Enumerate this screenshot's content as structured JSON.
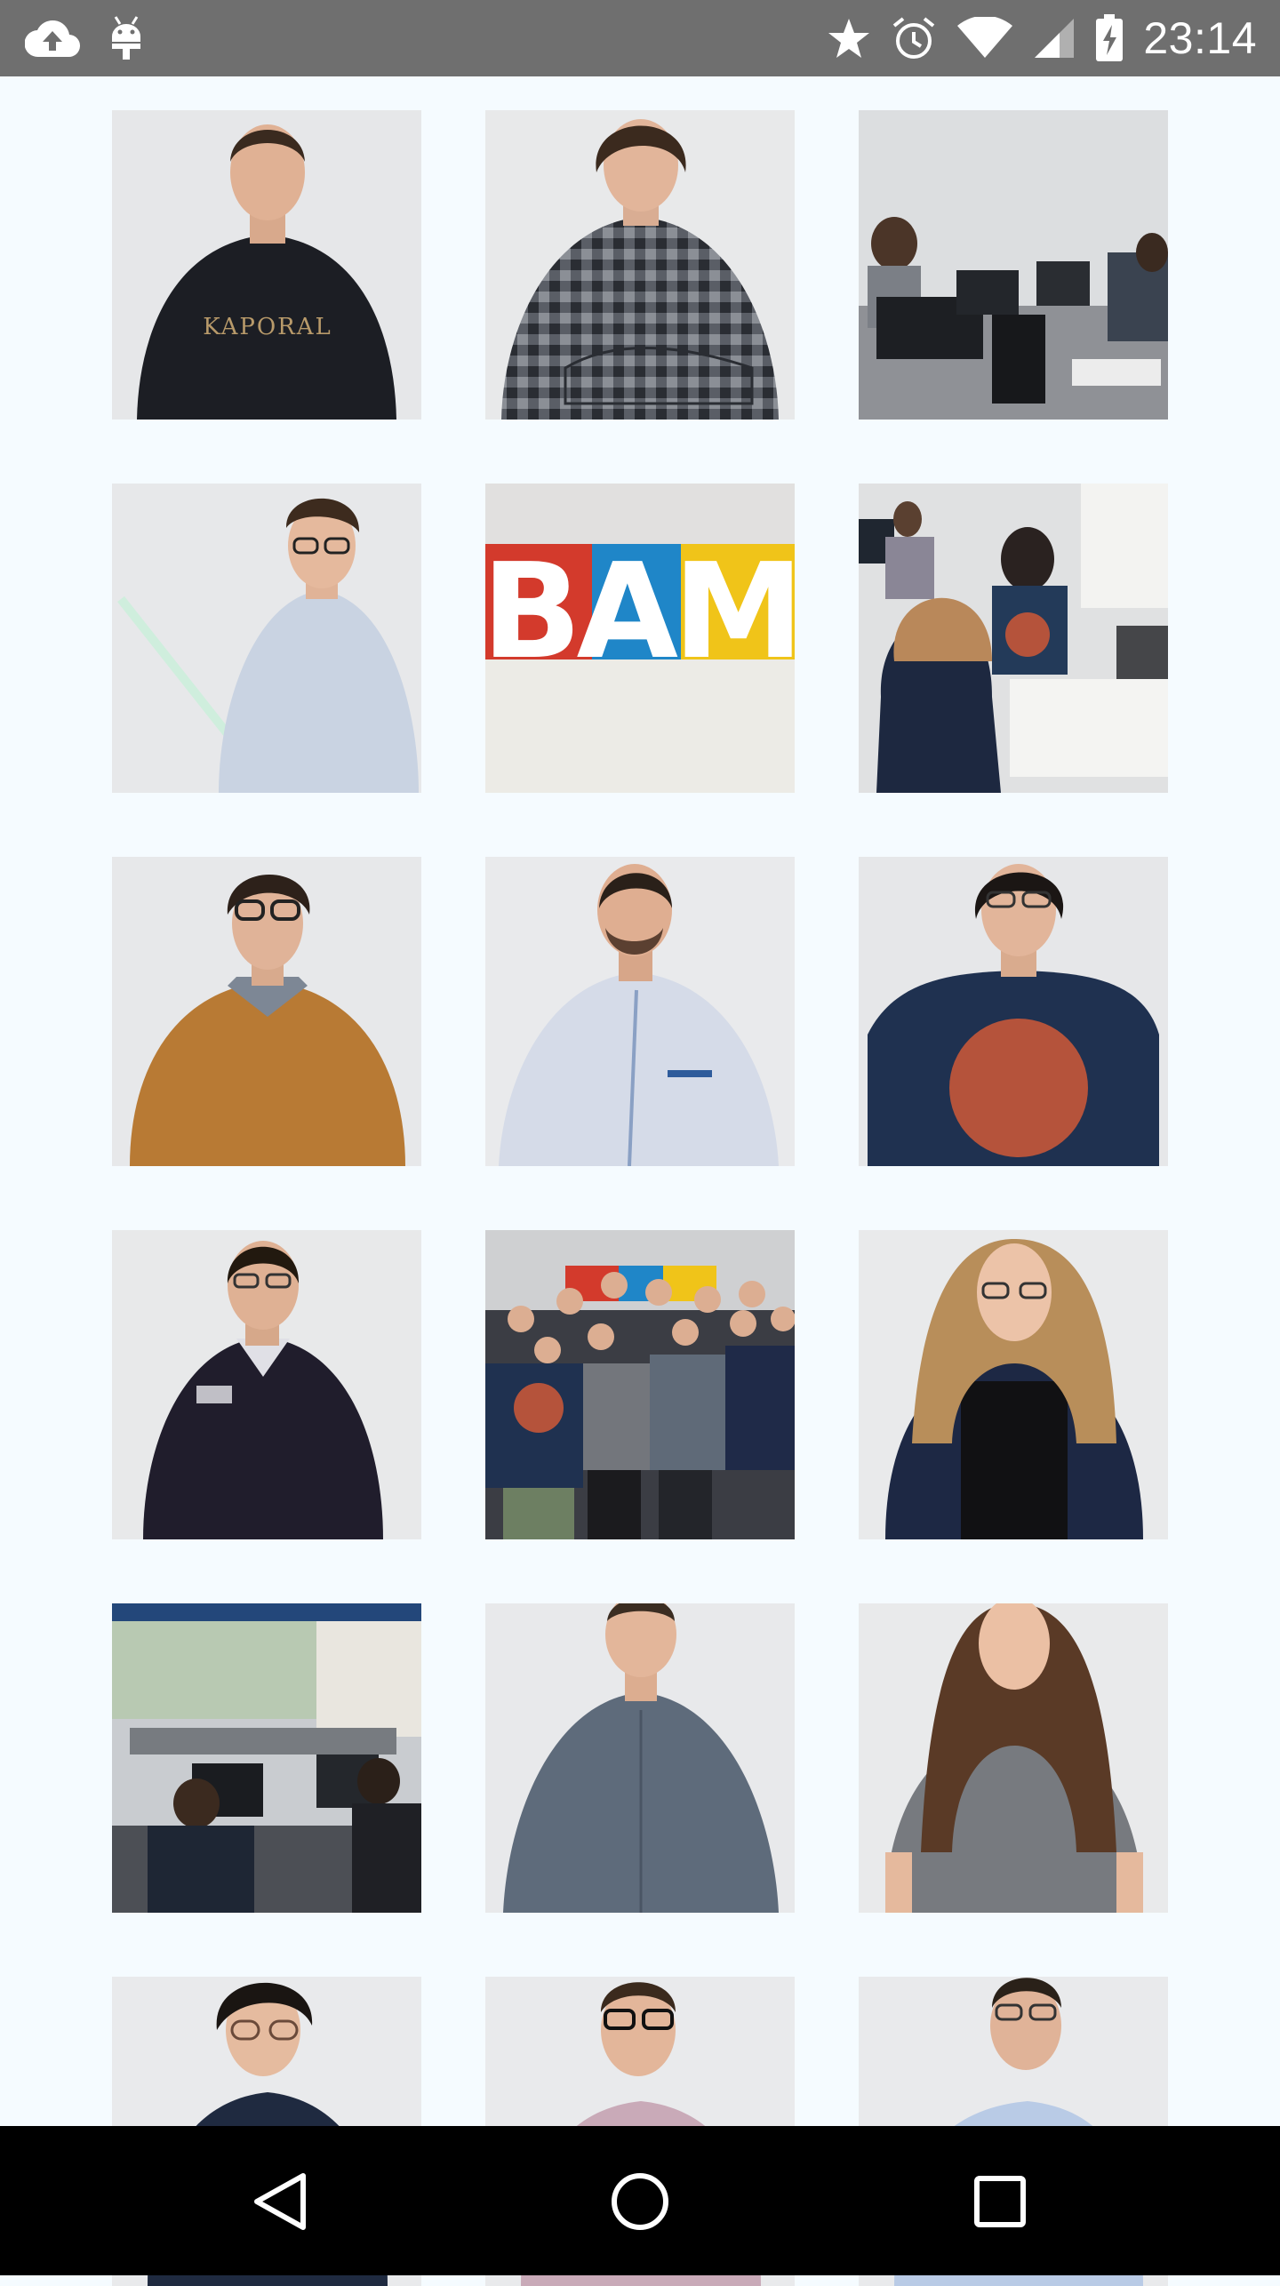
{
  "status_bar": {
    "time": "23:14",
    "icons": [
      "cloud-upload-icon",
      "android-debug-icon",
      "star-icon",
      "alarm-icon",
      "wifi-icon",
      "signal-icon",
      "battery-charging-icon"
    ]
  },
  "gallery": {
    "photos": [
      {
        "subject": "portrait",
        "shirt_text": "KAPORAL"
      },
      {
        "subject": "portrait"
      },
      {
        "subject": "office-desks"
      },
      {
        "subject": "portrait-lightsaber"
      },
      {
        "subject": "logo-sign",
        "logo_text": "BAM"
      },
      {
        "subject": "office-meeting"
      },
      {
        "subject": "portrait"
      },
      {
        "subject": "portrait"
      },
      {
        "subject": "portrait"
      },
      {
        "subject": "portrait"
      },
      {
        "subject": "team-group"
      },
      {
        "subject": "portrait"
      },
      {
        "subject": "office-open-space"
      },
      {
        "subject": "portrait"
      },
      {
        "subject": "portrait"
      },
      {
        "subject": "portrait"
      },
      {
        "subject": "portrait"
      },
      {
        "subject": "portrait"
      }
    ]
  },
  "colors": {
    "status_bar_bg": "#6f6f6f",
    "page_bg": "#f5fbff",
    "nav_bar_bg": "#000000",
    "logo_red": "#d33a2c",
    "logo_blue": "#1f86c8",
    "logo_yellow": "#f0c419"
  },
  "nav_bar": {
    "buttons": [
      "back-icon",
      "home-icon",
      "recents-icon"
    ]
  }
}
